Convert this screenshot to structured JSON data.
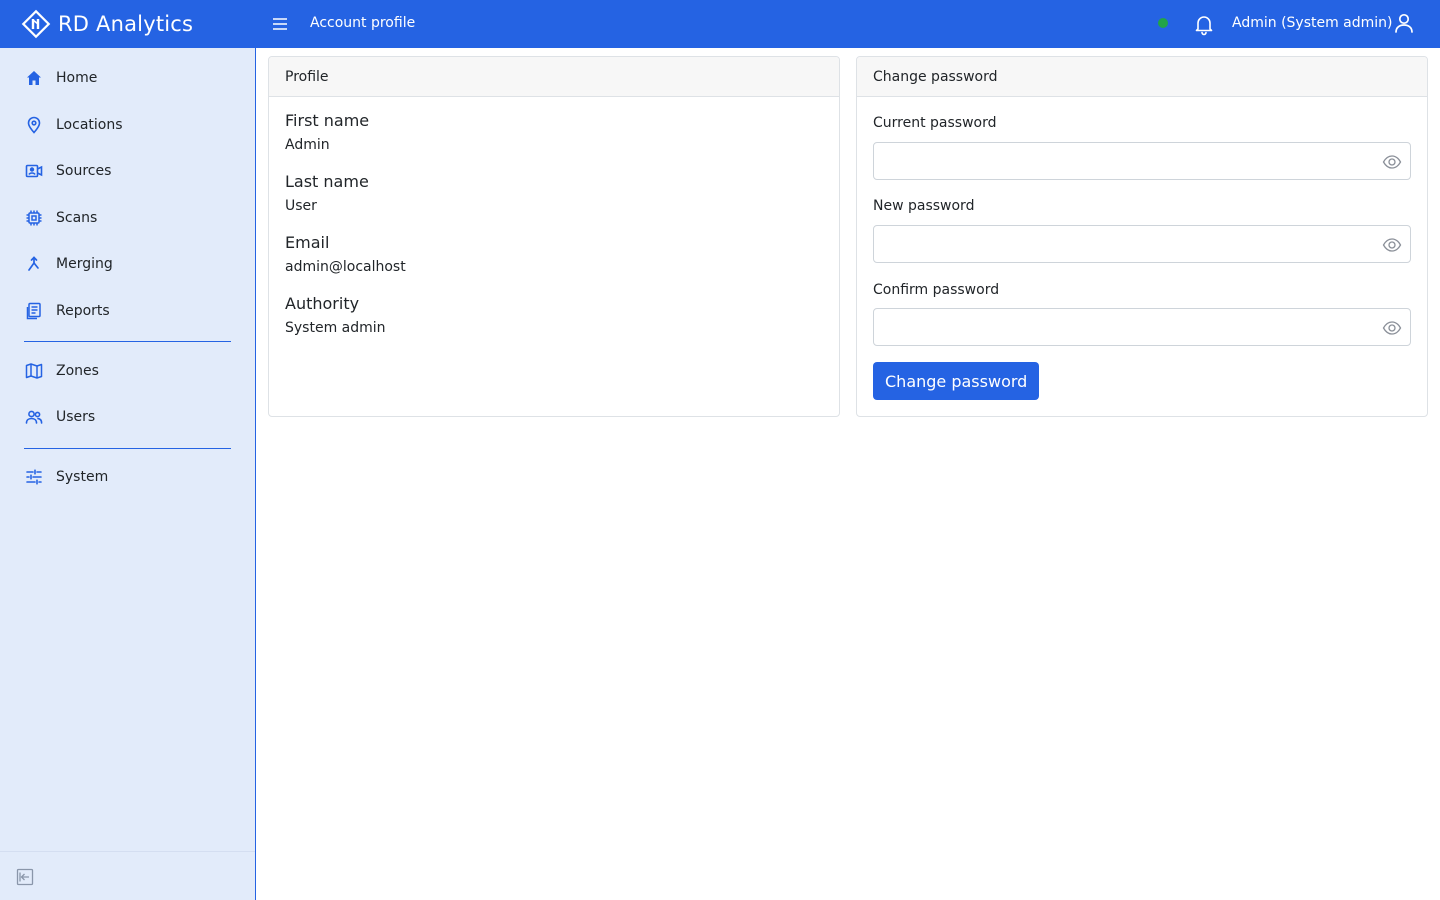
{
  "app": {
    "brand_name": "RD Analytics",
    "brand_color": "#2563e3"
  },
  "header": {
    "page_title": "Account profile",
    "status_color": "#22a447",
    "user_label": "Admin (System admin)"
  },
  "sidebar": {
    "items": [
      {
        "label": "Home",
        "icon": "home-icon"
      },
      {
        "label": "Locations",
        "icon": "map-pin-icon"
      },
      {
        "label": "Sources",
        "icon": "video-camera-icon"
      },
      {
        "label": "Scans",
        "icon": "chip-icon"
      },
      {
        "label": "Merging",
        "icon": "merge-icon"
      },
      {
        "label": "Reports",
        "icon": "report-icon"
      },
      {
        "label": "Zones",
        "icon": "map-icon"
      },
      {
        "label": "Users",
        "icon": "users-icon"
      },
      {
        "label": "System",
        "icon": "sliders-icon"
      }
    ]
  },
  "profile": {
    "title": "Profile",
    "fields": [
      {
        "label": "First name",
        "value": "Admin"
      },
      {
        "label": "Last name",
        "value": "User"
      },
      {
        "label": "Email",
        "value": "admin@localhost"
      },
      {
        "label": "Authority",
        "value": "System admin"
      }
    ]
  },
  "password": {
    "title": "Change password",
    "fields": [
      {
        "label": "Current password",
        "value": ""
      },
      {
        "label": "New password",
        "value": ""
      },
      {
        "label": "Confirm password",
        "value": ""
      }
    ],
    "submit_label": "Change password"
  }
}
